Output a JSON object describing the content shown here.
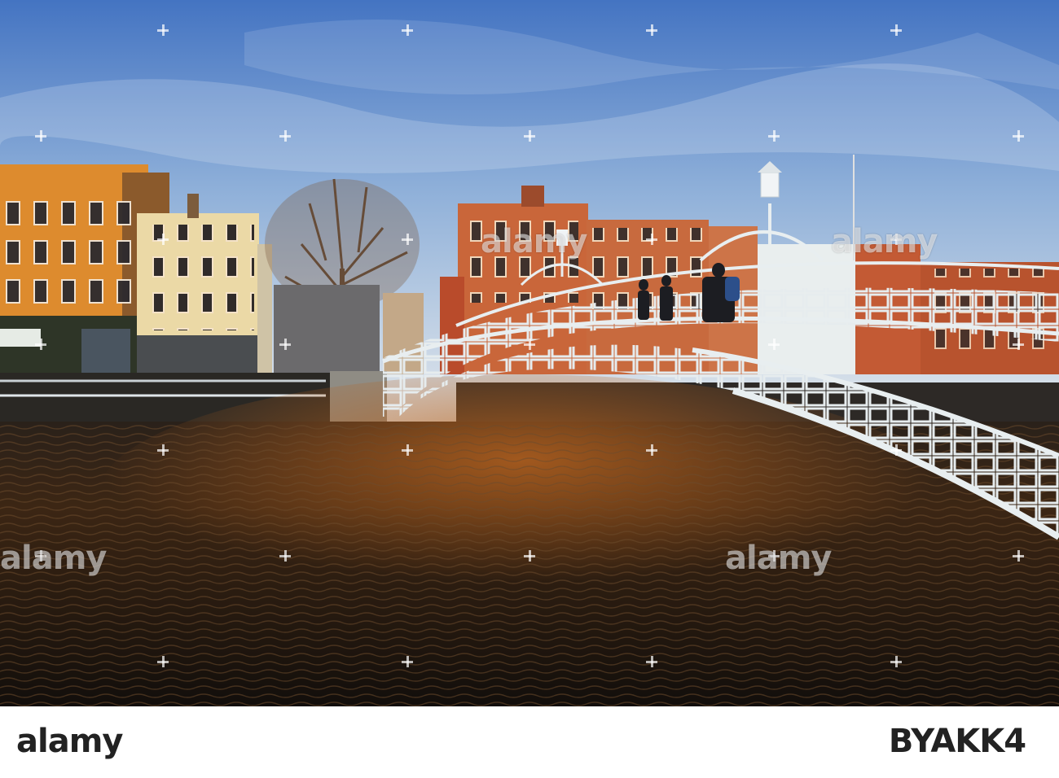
{
  "photo": {
    "subject": "",
    "watermark_text": "alamy"
  },
  "footer": {
    "logo_text": "alamy",
    "image_id": "BYAKK4"
  },
  "colors": {
    "sky_top": "#4f7ac4",
    "sky_bottom": "#dde6ef",
    "water": "#1b1510",
    "brick_orange": "#c8672f",
    "bridge": "#e8eef0"
  }
}
